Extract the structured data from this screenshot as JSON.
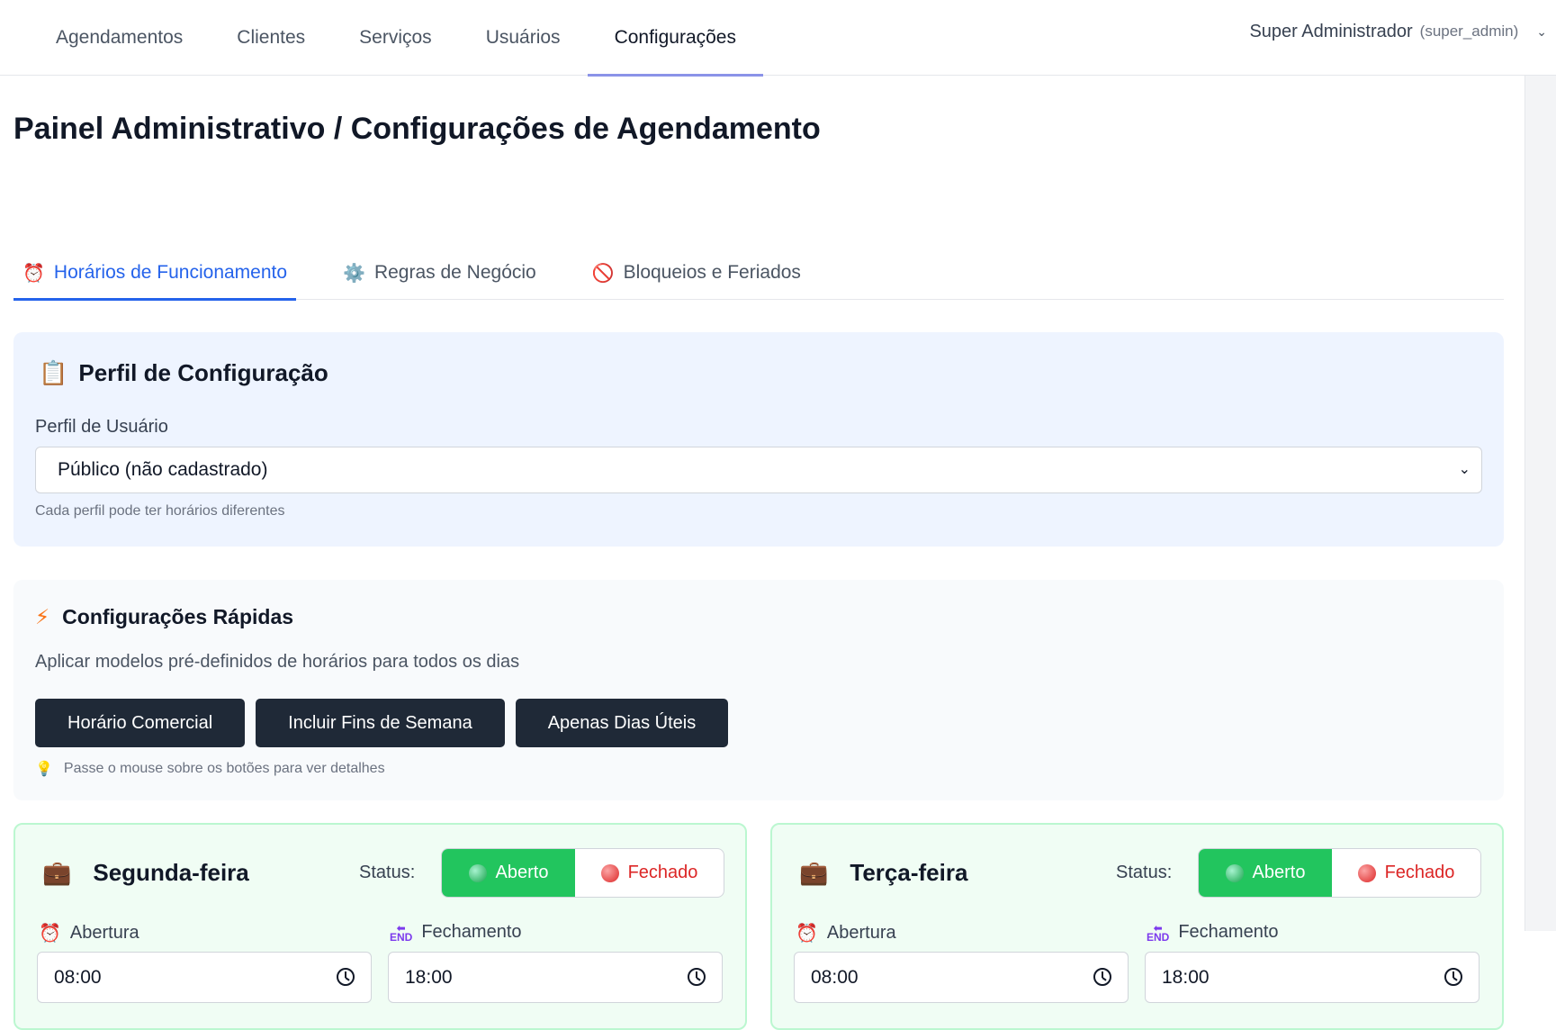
{
  "nav": {
    "items": [
      "Agendamentos",
      "Clientes",
      "Serviços",
      "Usuários",
      "Configurações"
    ],
    "active_index": 4,
    "user_name": "Super Administrador",
    "user_role": "(super_admin)"
  },
  "page_title": "Painel Administrativo / Configurações de Agendamento",
  "tabs": [
    {
      "icon": "alarm-clock-icon",
      "label": "Horários de Funcionamento",
      "active": true
    },
    {
      "icon": "gear-icon",
      "label": "Regras de Negócio",
      "active": false
    },
    {
      "icon": "prohibited-icon",
      "label": "Bloqueios e Feriados",
      "active": false
    }
  ],
  "profile": {
    "title": "Perfil de Configuração",
    "label": "Perfil de Usuário",
    "selected": "Público (não cadastrado)",
    "hint": "Cada perfil pode ter horários diferentes"
  },
  "quick": {
    "title": "Configurações Rápidas",
    "description": "Aplicar modelos pré-definidos de horários para todos os dias",
    "buttons": [
      "Horário Comercial",
      "Incluir Fins de Semana",
      "Apenas Dias Úteis"
    ],
    "tip": "Passe o mouse sobre os botões para ver detalhes"
  },
  "days": [
    {
      "name": "Segunda-feira",
      "status_label": "Status:",
      "open_label": "Aberto",
      "closed_label": "Fechado",
      "status": "open",
      "opening_label": "Abertura",
      "closing_label": "Fechamento",
      "opening": "08:00",
      "closing": "18:00"
    },
    {
      "name": "Terça-feira",
      "status_label": "Status:",
      "open_label": "Aberto",
      "closed_label": "Fechado",
      "status": "open",
      "opening_label": "Abertura",
      "closing_label": "Fechamento",
      "opening": "08:00",
      "closing": "18:00"
    }
  ],
  "colors": {
    "accent": "#2563eb",
    "open": "#22c55e",
    "closed": "#dc2626",
    "dark_button": "#1f2937"
  }
}
